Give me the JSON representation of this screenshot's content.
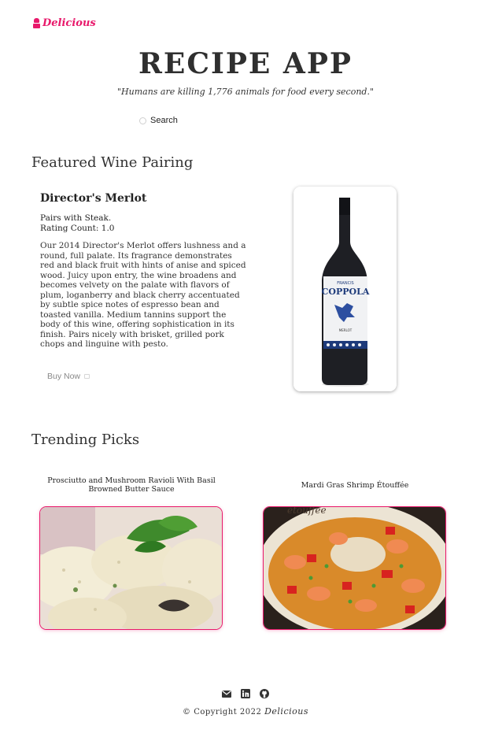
{
  "logo": {
    "text": "Delicious",
    "icon": "chef-icon"
  },
  "header": {
    "title": "RECIPE APP",
    "quote": "\"Humans are killing 1,776 animals for food every second.\""
  },
  "search": {
    "placeholder": "Search",
    "icon": "search-icon"
  },
  "wine_section": {
    "heading": "Featured Wine Pairing",
    "name": "Director's Merlot",
    "pairs_with": "Pairs with Steak.",
    "rating": "Rating Count: 1.0",
    "description": "Our 2014 Director's Merlot offers lushness and a round, full palate. Its fragrance demonstrates red and black fruit with hints of anise and spiced wood. Juicy upon entry, the wine broadens and becomes velvety on the palate with flavors of plum, loganberry and black cherry accentuated by subtle spice notes of espresso bean and toasted vanilla. Medium tannins support the body of this wine, offering sophistication in its finish. Pairs nicely with brisket, grilled pork chops and linguine with pesto.",
    "buy_label": "Buy Now",
    "bottle_label_top": "FRANCIS",
    "bottle_label_brand": "COPPOLA",
    "bottle_label_sub": "MERLOT"
  },
  "trending": {
    "heading": "Trending Picks",
    "items": [
      {
        "title": "Prosciutto and Mushroom Ravioli With Basil Browned Butter Sauce"
      },
      {
        "title": "Mardi Gras Shrimp Étouffée",
        "image_text": "étouffée"
      }
    ]
  },
  "footer": {
    "copyright": "© Copyright 2022",
    "brand": "Delicious",
    "icons": [
      "mail-icon",
      "linkedin-icon",
      "github-icon"
    ]
  },
  "colors": {
    "accent": "#e8196b",
    "text": "#2f2f2f"
  }
}
